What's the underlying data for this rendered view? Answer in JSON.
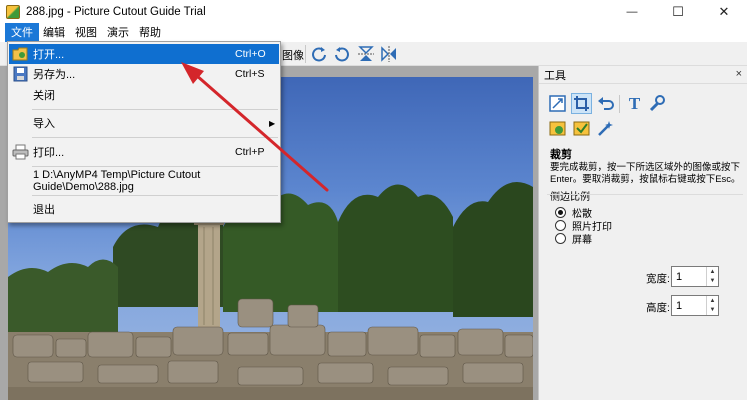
{
  "window": {
    "title": "288.jpg - Picture Cutout Guide Trial",
    "minimize_glyph": "—",
    "maximize_glyph": "☐",
    "close_glyph": "✕"
  },
  "menubar": [
    "文件",
    "编辑",
    "视图",
    "演示",
    "帮助"
  ],
  "toolbar": {
    "image_label": "图像"
  },
  "file_menu": {
    "open": {
      "label": "打开...",
      "shortcut": "Ctrl+O"
    },
    "save_as": {
      "label": "另存为...",
      "shortcut": "Ctrl+S"
    },
    "close": {
      "label": "关闭"
    },
    "import": {
      "label": "导入"
    },
    "print": {
      "label": "打印...",
      "shortcut": "Ctrl+P"
    },
    "recent": {
      "label": "1 D:\\AnyMP4 Temp\\Picture Cutout Guide\\Demo\\288.jpg"
    },
    "exit": {
      "label": "退出"
    }
  },
  "tools_panel": {
    "title": "工具",
    "close_glyph": "×",
    "section_title": "裁剪",
    "description": "要完成裁剪，按一下所选区域外的图像或按下Enter。要取消裁剪，按鼠标右键或按下Esc。",
    "ratio_title": "侧边比例",
    "ratio_options": [
      {
        "label": "松散",
        "selected": true
      },
      {
        "label": "照片打印",
        "selected": false
      },
      {
        "label": "屏幕",
        "selected": false
      }
    ],
    "width_label": "宽度:",
    "width_value": "1",
    "height_label": "高度:",
    "height_value": "1"
  },
  "colors": {
    "menu_highlight": "#0f6fd0",
    "annotation_arrow": "#d4262b"
  }
}
